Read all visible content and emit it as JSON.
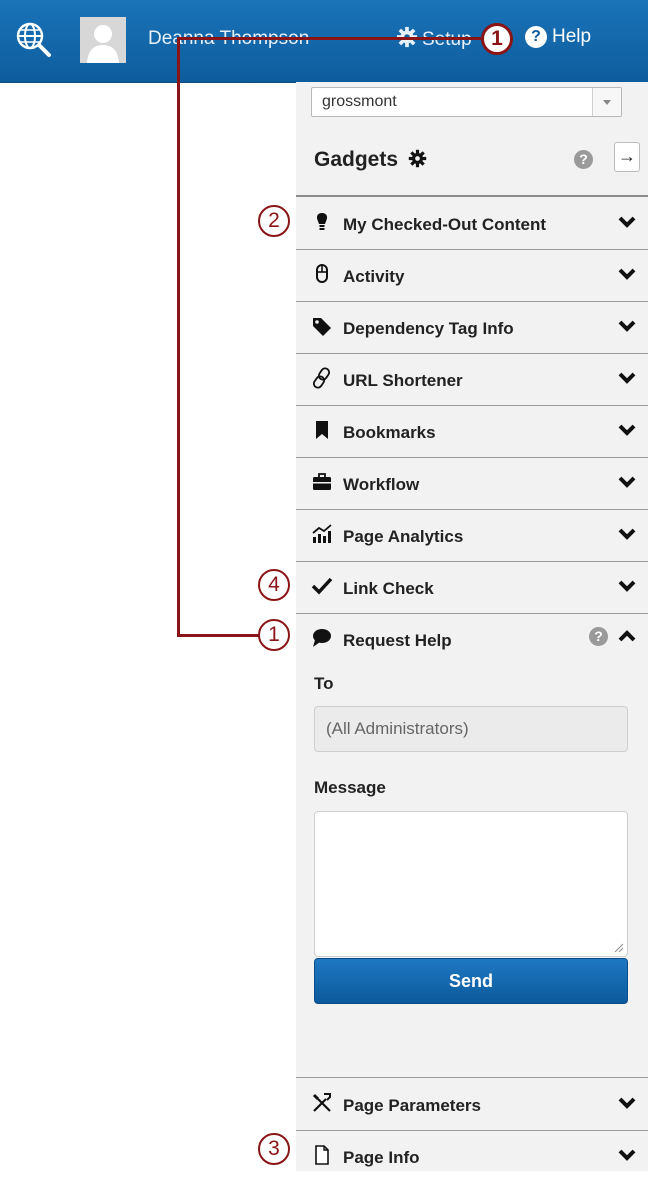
{
  "topbar": {
    "user_name": "Deanna Thompson",
    "setup_label": "Setup",
    "help_label": "Help",
    "icons": {
      "globe": "globe-search-icon",
      "avatar": "user-avatar",
      "setup": "gear-icon",
      "help": "question-circle-icon"
    },
    "colors": {
      "bar": "#0d5d9d"
    }
  },
  "panel": {
    "site_select": {
      "value": "grossmont"
    },
    "title": "Gadgets",
    "help_icon": "?",
    "collapse_icon": "→"
  },
  "gadgets": [
    {
      "label": "My Checked-Out Content",
      "icon": "lightbulb-icon"
    },
    {
      "label": "Activity",
      "icon": "mouse-icon"
    },
    {
      "label": "Dependency Tag Info",
      "icon": "tag-icon"
    },
    {
      "label": "URL Shortener",
      "icon": "link-icon"
    },
    {
      "label": "Bookmarks",
      "icon": "bookmark-icon"
    },
    {
      "label": "Workflow",
      "icon": "briefcase-icon"
    },
    {
      "label": "Page Analytics",
      "icon": "analytics-icon"
    },
    {
      "label": "Link Check",
      "icon": "checkmark-icon"
    }
  ],
  "request_help": {
    "title": "Request Help",
    "icon": "speech-bubble-icon",
    "to_label": "To",
    "to_value": "(All Administrators)",
    "message_label": "Message",
    "message_value": "",
    "send_label": "Send"
  },
  "bottom_gadgets": [
    {
      "label": "Page Parameters",
      "icon": "tools-icon"
    },
    {
      "label": "Page Info",
      "icon": "document-icon"
    }
  ],
  "annotations": {
    "color": "#8b1416",
    "badges": [
      "1",
      "2",
      "4",
      "1",
      "3"
    ]
  }
}
